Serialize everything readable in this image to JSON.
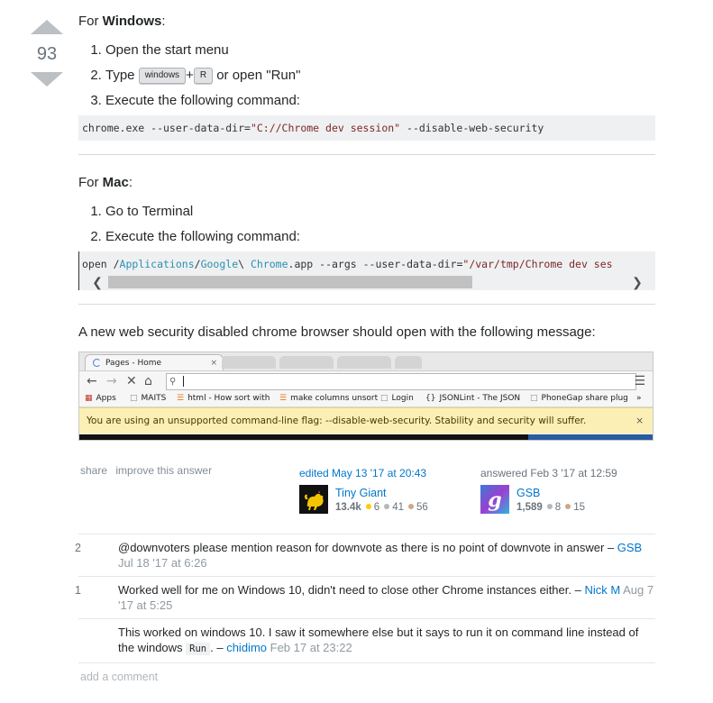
{
  "vote": {
    "count": "93"
  },
  "windows": {
    "heading_prefix": "For ",
    "heading_bold": "Windows",
    "heading_suffix": ":",
    "step1": "Open the start menu",
    "step2_prefix": "Type ",
    "kbd_windows": "windows",
    "plus": "+",
    "kbd_r": "R",
    "step2_suffix": " or open \"Run\"",
    "step3": "Execute the following command:",
    "cmd_part1": "chrome.exe --user-data-dir=",
    "cmd_str": "\"C://Chrome dev session\"",
    "cmd_part2": " --disable-web-security"
  },
  "mac": {
    "heading_prefix": "For ",
    "heading_bold": "Mac",
    "heading_suffix": ":",
    "step1": "Go to Terminal",
    "step2": "Execute the following command:",
    "cmd_open": "open /",
    "cmd_applications": "Applications",
    "cmd_slash1": "/",
    "cmd_google": "Google",
    "cmd_escape": "\\ ",
    "cmd_chrome": "Chrome",
    "cmd_app_args": ".app --args --user-data-dir=",
    "cmd_str": "\"/var/tmp/Chrome dev ses"
  },
  "message_intro": "A new web security disabled chrome browser should open with the following message:",
  "screenshot": {
    "tab_title": "Pages - Home",
    "bookmarks": [
      {
        "label": "Apps"
      },
      {
        "label": "MAITS"
      },
      {
        "label": "html - How sort with"
      },
      {
        "label": "make columns unsort"
      },
      {
        "label": "Login"
      },
      {
        "label": "JSONLint - The JSON"
      },
      {
        "label": "PhoneGap share plug"
      }
    ],
    "overflow": "»",
    "warning": "You are using an unsupported command-line flag: --disable-web-security. Stability and security will suffer.",
    "close": "×"
  },
  "post_menu": {
    "share": "share",
    "improve": "improve this answer"
  },
  "editor": {
    "action": "edited May 13 '17 at 20:43",
    "name": "Tiny Giant",
    "rep": "13.4k",
    "gold": "6",
    "silver": "41",
    "bronze": "56"
  },
  "owner": {
    "action": "answered Feb 3 '17 at 12:59",
    "name": "GSB",
    "rep": "1,589",
    "silver": "8",
    "bronze": "15"
  },
  "colors": {
    "gold": "#ffcc01",
    "silver": "#b4b8bc",
    "bronze": "#d1a684",
    "link": "#0077cc"
  },
  "comments": [
    {
      "score": "2",
      "text": "@downvoters please mention reason for downvote as there is no point of downvote in answer",
      "dash": " – ",
      "user": "GSB",
      "date": "Jul 18 '17 at 6:26"
    },
    {
      "score": "1",
      "text": "Worked well for me on Windows 10, didn't need to close other Chrome instances either.",
      "dash": " – ",
      "user": "Nick M",
      "date": "Aug 7 '17 at 5:25"
    },
    {
      "score": "",
      "text": "This worked on windows 10. I saw it somewhere else but it says to run it on command line instead of the windows ",
      "code": "Run",
      "text_after": ". – ",
      "user": "chidimo",
      "date": "Feb 17 at 23:22"
    }
  ],
  "add_comment": "add a comment"
}
